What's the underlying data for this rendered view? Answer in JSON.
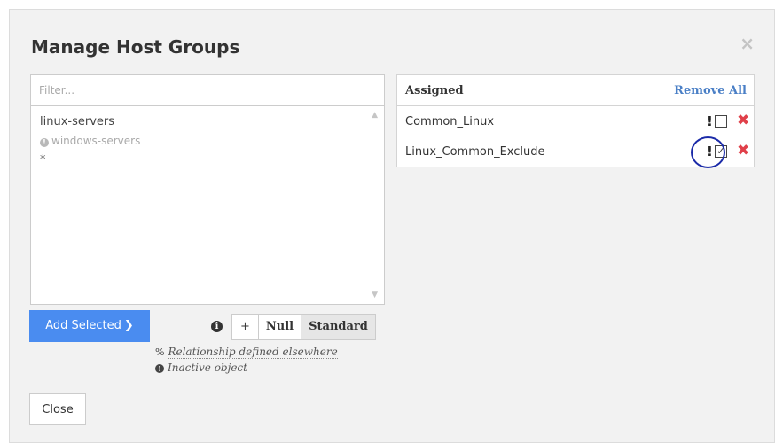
{
  "dialog": {
    "title": "Manage Host Groups",
    "close_icon": "×"
  },
  "filter": {
    "placeholder": "Filter..."
  },
  "available_list": {
    "items": [
      {
        "label": "linux-servers",
        "inactive": false
      },
      {
        "label": "windows-servers",
        "inactive": true
      },
      {
        "label": "*",
        "inactive": false
      }
    ]
  },
  "buttons": {
    "add_selected": "Add Selected",
    "add_selected_chevron": "❯",
    "close": "Close"
  },
  "relationship_toggle": {
    "options": [
      "+",
      "Null",
      "Standard"
    ],
    "active": "Standard"
  },
  "legend": {
    "relationship_icon": "%",
    "relationship": "Relationship defined elsewhere",
    "inactive_icon": "!",
    "inactive": "Inactive object"
  },
  "assigned": {
    "title": "Assigned",
    "remove_all": "Remove All",
    "rows": [
      {
        "name": "Common_Linux",
        "flag": "!",
        "checked": false,
        "delete": "✖"
      },
      {
        "name": "Linux_Common_Exclude",
        "flag": "!",
        "checked": true,
        "delete": "✖"
      }
    ]
  },
  "colors": {
    "primary_button": "#4a8cf0",
    "link": "#4a7fc6",
    "delete": "#e0404a",
    "highlight_circle": "#1a2aa8"
  }
}
